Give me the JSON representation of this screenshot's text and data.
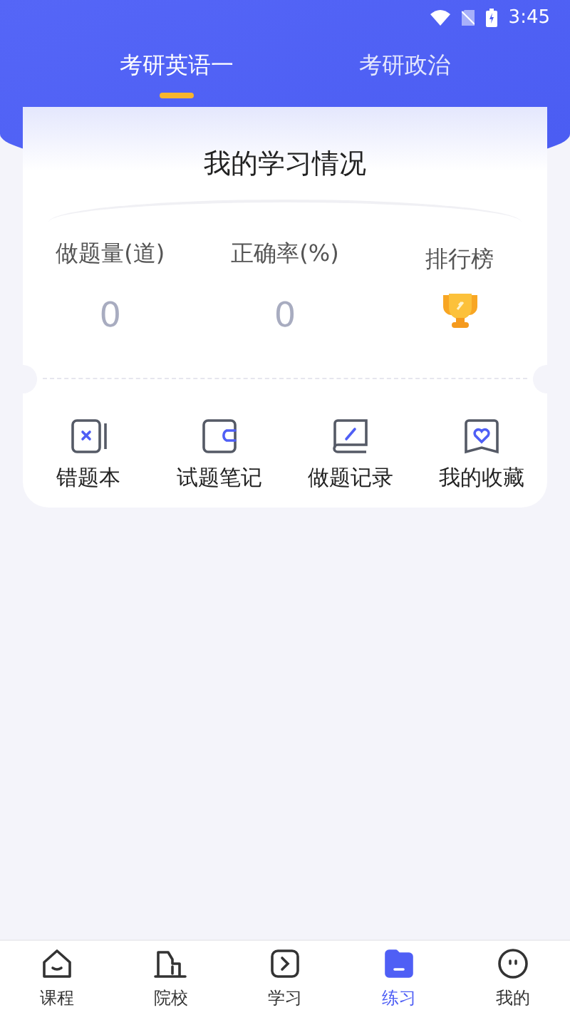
{
  "status_bar": {
    "time": "3:45"
  },
  "tabs": [
    {
      "label": "考研英语一",
      "selected": true
    },
    {
      "label": "考研政治",
      "selected": false
    }
  ],
  "card": {
    "title": "我的学习情况",
    "stats": [
      {
        "kind": "number",
        "label": "做题量(道)",
        "value": "0"
      },
      {
        "kind": "number",
        "label": "正确率(%)",
        "value": "0"
      },
      {
        "kind": "trophy",
        "label": "排行榜"
      }
    ],
    "actions": [
      {
        "kind": "wrong",
        "label": "错题本"
      },
      {
        "kind": "note",
        "label": "试题笔记"
      },
      {
        "kind": "record",
        "label": "做题记录"
      },
      {
        "kind": "favorite",
        "label": "我的收藏"
      }
    ]
  },
  "bottom_nav": [
    {
      "kind": "home",
      "label": "课程",
      "selected": false
    },
    {
      "kind": "school",
      "label": "院校",
      "selected": false
    },
    {
      "kind": "study",
      "label": "学习",
      "selected": false
    },
    {
      "kind": "practice",
      "label": "练习",
      "selected": true
    },
    {
      "kind": "me",
      "label": "我的",
      "selected": false
    }
  ]
}
